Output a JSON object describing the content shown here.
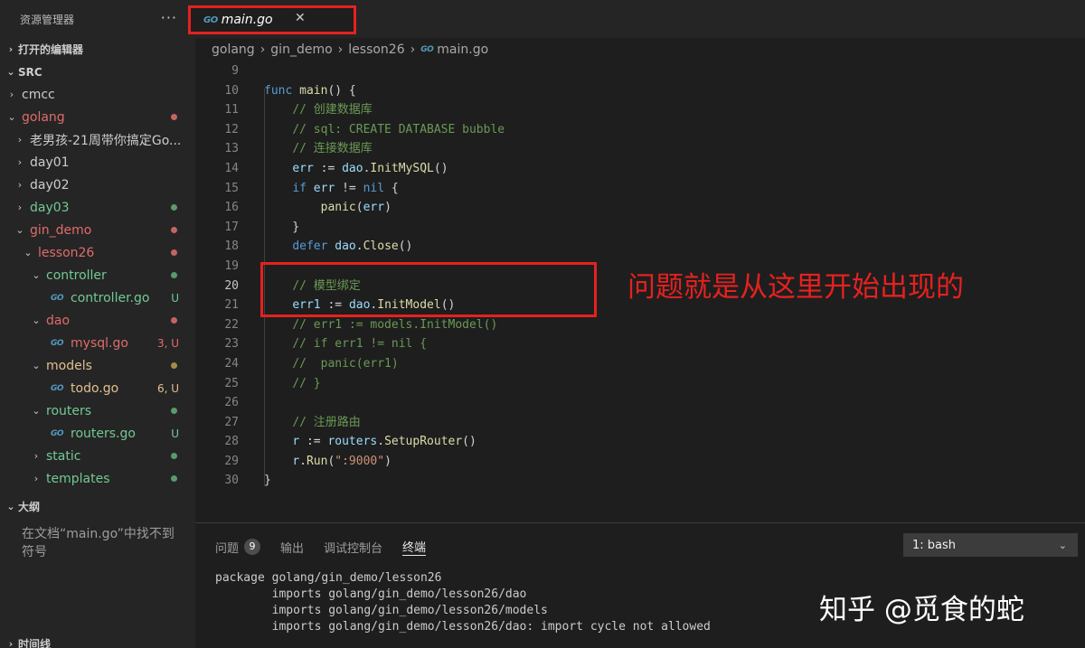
{
  "sidebar": {
    "title": "资源管理器",
    "more": "···",
    "open_editors": "打开的编辑器",
    "root": "SRC",
    "items": [
      {
        "label": "cmcc",
        "chev": "›",
        "color": "#cccccc",
        "depth": 1,
        "status": ""
      },
      {
        "label": "golang",
        "chev": "⌄",
        "color": "#e06c68",
        "depth": 1,
        "status": "dot-red"
      },
      {
        "label": "老男孩-21周带你搞定Go...",
        "chev": "›",
        "color": "#cccccc",
        "depth": 2,
        "status": ""
      },
      {
        "label": "day01",
        "chev": "›",
        "color": "#cccccc",
        "depth": 2,
        "status": ""
      },
      {
        "label": "day02",
        "chev": "›",
        "color": "#cccccc",
        "depth": 2,
        "status": ""
      },
      {
        "label": "day03",
        "chev": "›",
        "color": "#73c991",
        "depth": 2,
        "status": "dot-green"
      },
      {
        "label": "gin_demo",
        "chev": "⌄",
        "color": "#e06c68",
        "depth": 2,
        "status": "dot-red"
      },
      {
        "label": "lesson26",
        "chev": "⌄",
        "color": "#e06c68",
        "depth": 3,
        "status": "dot-red"
      },
      {
        "label": "controller",
        "chev": "⌄",
        "color": "#73c991",
        "depth": 4,
        "status": "dot-green"
      },
      {
        "label": "controller.go",
        "chev": "",
        "color": "#73c991",
        "depth": 5,
        "status": "U",
        "go": true
      },
      {
        "label": "dao",
        "chev": "⌄",
        "color": "#e06c68",
        "depth": 4,
        "status": "dot-red"
      },
      {
        "label": "mysql.go",
        "chev": "",
        "color": "#e06c68",
        "depth": 5,
        "status": "3, U",
        "go": true
      },
      {
        "label": "models",
        "chev": "⌄",
        "color": "#e2c08d",
        "depth": 4,
        "status": "dot-yellow"
      },
      {
        "label": "todo.go",
        "chev": "",
        "color": "#e2c08d",
        "depth": 5,
        "status": "6, U",
        "go": true
      },
      {
        "label": "routers",
        "chev": "⌄",
        "color": "#73c991",
        "depth": 4,
        "status": "dot-green"
      },
      {
        "label": "routers.go",
        "chev": "",
        "color": "#73c991",
        "depth": 5,
        "status": "U",
        "go": true
      },
      {
        "label": "static",
        "chev": "›",
        "color": "#73c991",
        "depth": 4,
        "status": "dot-green"
      },
      {
        "label": "templates",
        "chev": "›",
        "color": "#73c991",
        "depth": 4,
        "status": "dot-green"
      }
    ],
    "outline_title": "大纲",
    "outline_msg": "在文档“main.go”中找不到符号",
    "timeline_title": "时间线"
  },
  "tab": {
    "icon": "go-icon",
    "label": "main.go",
    "close": "✕"
  },
  "breadcrumb": [
    "golang",
    "gin_demo",
    "lesson26",
    "main.go"
  ],
  "code": {
    "current_line": 20,
    "lines": [
      {
        "n": "9",
        "html": ""
      },
      {
        "n": "10",
        "html": "<span class=\"kw\">func</span> <span class=\"fn\">main</span>() {"
      },
      {
        "n": "11",
        "html": "    <span class=\"cm\">// 创建数据库</span>"
      },
      {
        "n": "12",
        "html": "    <span class=\"cm\">// sql: CREATE DATABASE bubble</span>"
      },
      {
        "n": "13",
        "html": "    <span class=\"cm\">// 连接数据库</span>"
      },
      {
        "n": "14",
        "html": "    <span class=\"var\">err</span> := <span class=\"var\">dao</span>.<span class=\"fn\">InitMySQL</span>()"
      },
      {
        "n": "15",
        "html": "    <span class=\"kw\">if</span> <span class=\"var\">err</span> != <span class=\"kw\">nil</span> {"
      },
      {
        "n": "16",
        "html": "        <span class=\"fn\">panic</span>(<span class=\"var\">err</span>)"
      },
      {
        "n": "17",
        "html": "    }"
      },
      {
        "n": "18",
        "html": "    <span class=\"kw\">defer</span> <span class=\"var\">dao</span>.<span class=\"fn\">Close</span>()"
      },
      {
        "n": "19",
        "html": ""
      },
      {
        "n": "20",
        "html": "    <span class=\"cm\">// 模型绑定</span>"
      },
      {
        "n": "21",
        "html": "    <span class=\"var\">err1</span> := <span class=\"var\">dao</span>.<span class=\"fn\">InitModel</span>()"
      },
      {
        "n": "22",
        "html": "    <span class=\"cm\">// err1 := models.InitModel()</span>"
      },
      {
        "n": "23",
        "html": "    <span class=\"cm\">// if err1 != nil {</span>"
      },
      {
        "n": "24",
        "html": "    <span class=\"cm\">//  panic(err1)</span>"
      },
      {
        "n": "25",
        "html": "    <span class=\"cm\">// }</span>"
      },
      {
        "n": "26",
        "html": ""
      },
      {
        "n": "27",
        "html": "    <span class=\"cm\">// 注册路由</span>"
      },
      {
        "n": "28",
        "html": "    <span class=\"var\">r</span> := <span class=\"var\">routers</span>.<span class=\"fn\">SetupRouter</span>()"
      },
      {
        "n": "29",
        "html": "    <span class=\"var\">r</span>.<span class=\"fn\">Run</span>(<span class=\"str\">\":9000\"</span>)"
      },
      {
        "n": "30",
        "html": "}"
      }
    ]
  },
  "annotation": "问题就是从这里开始出现的",
  "panel": {
    "tabs": [
      {
        "label": "问题",
        "badge": "9",
        "active": false
      },
      {
        "label": "输出",
        "badge": "",
        "active": false
      },
      {
        "label": "调试控制台",
        "badge": "",
        "active": false
      },
      {
        "label": "终端",
        "badge": "",
        "active": true
      }
    ],
    "terminal_select": "1: bash",
    "terminal_output": "package golang/gin_demo/lesson26\n        imports golang/gin_demo/lesson26/dao\n        imports golang/gin_demo/lesson26/models\n        imports golang/gin_demo/lesson26/dao: import cycle not allowed"
  },
  "watermark": "知乎 @觅食的蛇",
  "colors": {
    "accent_red": "#e5211f",
    "git_untracked": "#73c991",
    "git_error": "#e06c68",
    "git_modified": "#e2c08d"
  }
}
